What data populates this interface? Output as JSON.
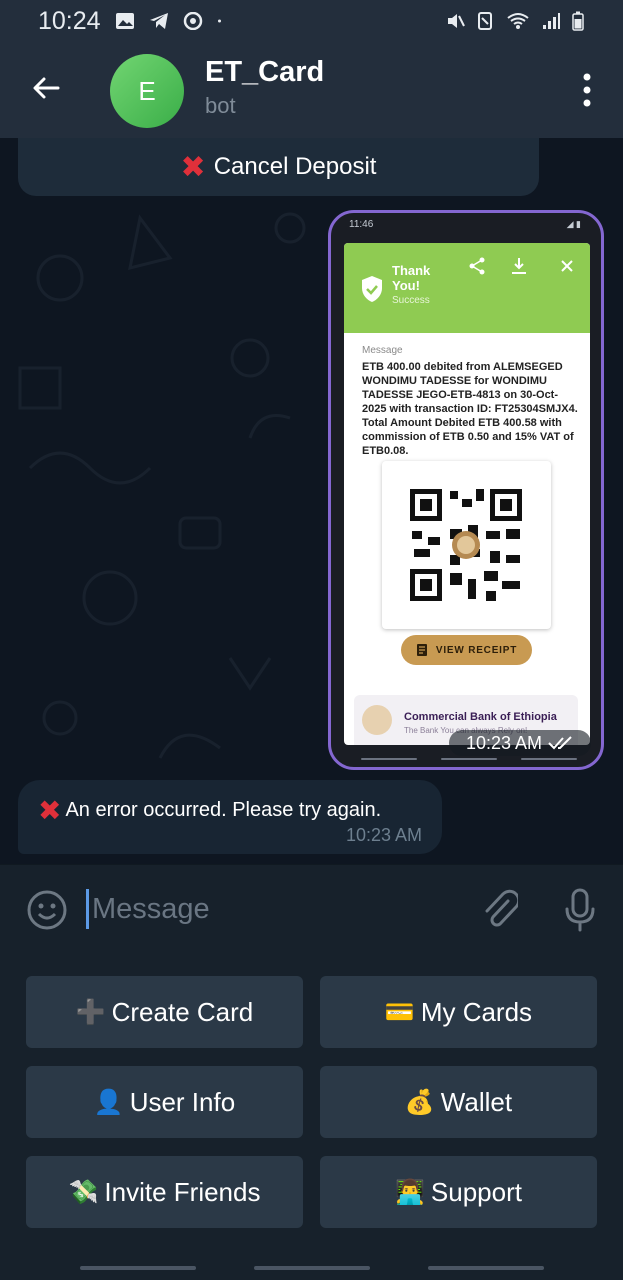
{
  "status_bar": {
    "time": "10:24",
    "icons_left": [
      "image-icon",
      "telegram-icon",
      "chrome-icon",
      "dot-icon"
    ],
    "icons_right": [
      "mute-icon",
      "nfc-icon",
      "wifi-icon",
      "signal-icon",
      "battery-icon"
    ]
  },
  "header": {
    "avatar_letter": "E",
    "title": "ET_Card",
    "subtitle": "bot"
  },
  "chat": {
    "previous_button": {
      "label": "Cancel Deposit"
    },
    "screenshot_message": {
      "mini_time": "11:46",
      "thanks": "Thank You!",
      "status": "Success",
      "message_label": "Message",
      "message_body": "ETB 400.00 debited from ALEMSEGED WONDIMU TADESSE for WONDIMU TADESSE JEGO-ETB-4813 on 30-Oct-2025 with transaction ID: FT25304SMJX4. Total Amount Debited ETB 400.58 with commission of ETB 0.50 and 15% VAT of ETB0.08.",
      "receipt_button": "VIEW RECEIPT",
      "bank_name": "Commercial Bank of Ethiopia",
      "bank_tagline": "The Bank You can always Rely on!",
      "time": "10:23 AM"
    },
    "error_message": {
      "text": "An error occurred. Please try again.",
      "time": "10:23 AM"
    }
  },
  "composer": {
    "placeholder": "Message"
  },
  "keyboard": {
    "buttons": [
      {
        "emoji": "➕",
        "label": "Create Card"
      },
      {
        "emoji": "💳",
        "label": "My Cards"
      },
      {
        "emoji": "👤",
        "label": "User Info"
      },
      {
        "emoji": "💰",
        "label": "Wallet"
      },
      {
        "emoji": "💸",
        "label": "Invite Friends"
      },
      {
        "emoji": "👨‍💻",
        "label": "Support"
      }
    ]
  },
  "colors": {
    "header_bg": "#232e3c",
    "chat_bg": "#0e1621",
    "accent": "#5c9ae6",
    "error_x": "#e0303a",
    "success_green": "#8fcb52",
    "keyboard_button": "#2b3947"
  }
}
